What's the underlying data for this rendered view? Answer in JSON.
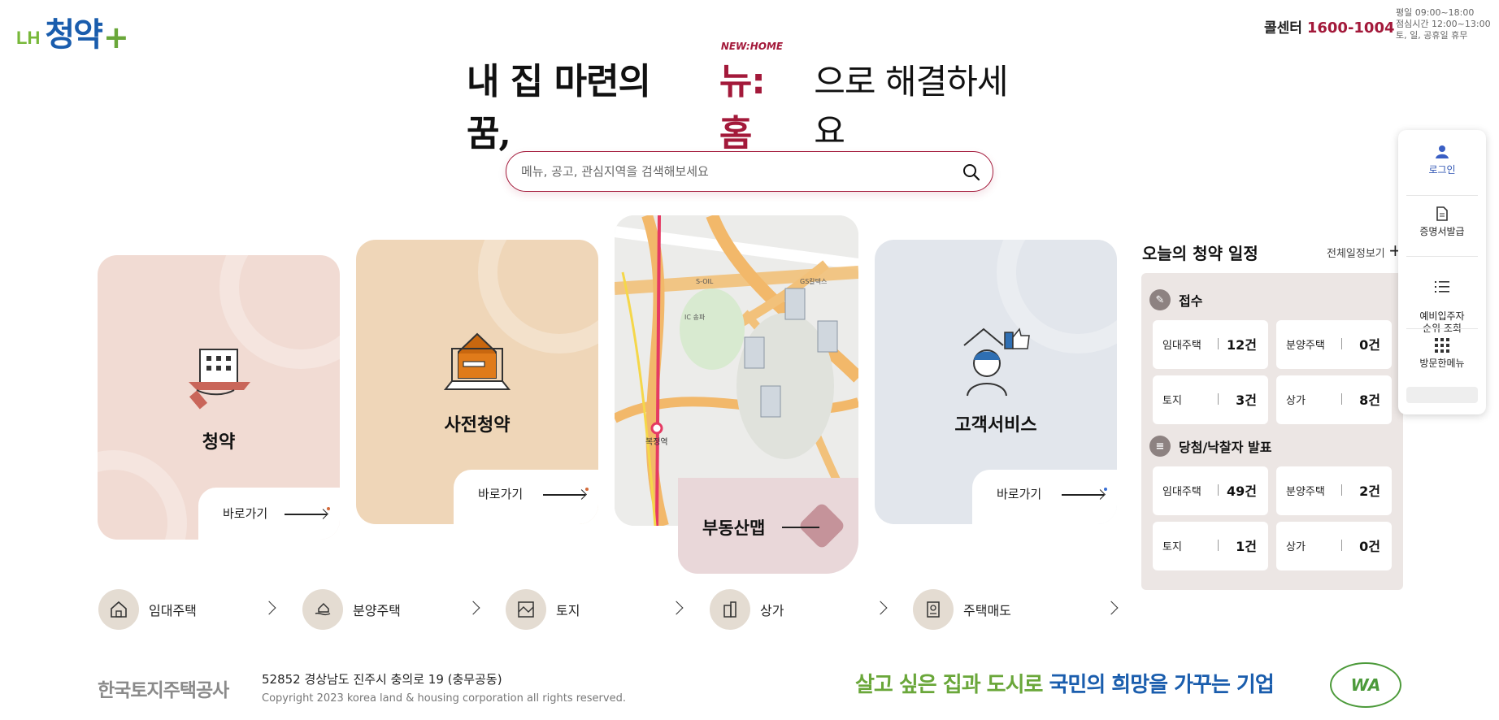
{
  "header": {
    "logo_prefix": "LH",
    "logo_text": "청약",
    "logo_plus": "+",
    "callcenter_label": "콜센터",
    "callcenter_number": "1600-1004",
    "hours": [
      "평일 09:00~18:00",
      "점심시간 12:00~13:00",
      "토, 일, 공휴일 휴무"
    ]
  },
  "hero": {
    "text_before": "내 집 마련의 꿈,",
    "brand_small": "NEW:HOME",
    "brand": "뉴:홈",
    "text_after": "으로 해결하세요"
  },
  "search": {
    "placeholder": "메뉴, 공고, 관심지역을 검색해보세요",
    "icon": "search-icon"
  },
  "cards": [
    {
      "title": "청약",
      "go": "바로가기",
      "color": "#f1dbd3",
      "dot": "#d36a3a"
    },
    {
      "title": "사전청약",
      "go": "바로가기",
      "color": "#efd6b8",
      "dot": "#d36a3a"
    },
    {
      "title": "부동산맵",
      "color": "#e9d7d9"
    },
    {
      "title": "고객서비스",
      "go": "바로가기",
      "color": "#e2e6ec",
      "dot": "#3a6fd3"
    }
  ],
  "schedule": {
    "title": "오늘의 청약 일정",
    "view_all": "전체일정보기",
    "sections": [
      {
        "title": "접수",
        "items": [
          {
            "label": "임대주택",
            "value": "12건"
          },
          {
            "label": "분양주택",
            "value": "0건"
          },
          {
            "label": "토지",
            "value": "3건"
          },
          {
            "label": "상가",
            "value": "8건"
          }
        ]
      },
      {
        "title": "당첨/낙찰자 발표",
        "items": [
          {
            "label": "임대주택",
            "value": "49건"
          },
          {
            "label": "분양주택",
            "value": "2건"
          },
          {
            "label": "토지",
            "value": "1건"
          },
          {
            "label": "상가",
            "value": "0건"
          }
        ]
      }
    ]
  },
  "sidebar": {
    "items": [
      {
        "label": "로그인",
        "icon": "user-icon"
      },
      {
        "label": "증명서발급",
        "icon": "document-icon"
      },
      {
        "label": "예비입주자\n순위 조회",
        "icon": "list-icon"
      },
      {
        "label": "방문한메뉴",
        "icon": "grid-icon"
      }
    ]
  },
  "categories": [
    {
      "label": "임대주택",
      "icon": "house-icon"
    },
    {
      "label": "분양주택",
      "icon": "handshake-house-icon"
    },
    {
      "label": "토지",
      "icon": "land-map-icon"
    },
    {
      "label": "상가",
      "icon": "building-icon"
    },
    {
      "label": "주택매도",
      "icon": "sale-document-icon"
    }
  ],
  "footer": {
    "org": "한국토지주택공사",
    "address": "52852 경상남도 진주시 충의로 19 (충무공동)",
    "copyright": "Copyright 2023 korea land & housing corporation all rights reserved.",
    "slogan_parts": [
      "살고 싶은 집과 도시로 ",
      "국민의 희망을 가꾸는 기업"
    ],
    "slogan_colors": [
      "#6aa73a",
      "#1a5dad"
    ],
    "wa_mark": "WA"
  },
  "map_labels": {
    "station": "복정역",
    "ic": "IC 송파",
    "gs": "GS칼텍스",
    "soil": "S-OIL"
  }
}
